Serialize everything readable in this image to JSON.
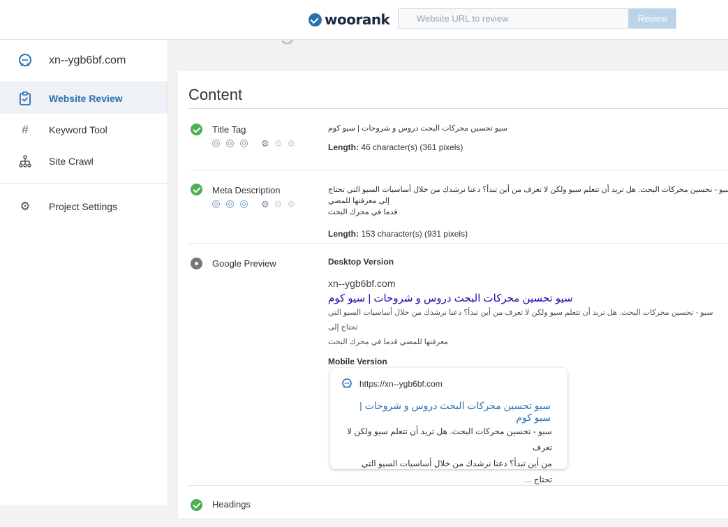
{
  "topbar": {
    "logo_text": "woorank",
    "url_placeholder": "Website URL to review",
    "review_label": "Review"
  },
  "sidebar": {
    "site_name": "xn--ygb6bf.com",
    "items": [
      {
        "label": "Website Review",
        "icon": "clipboard-check-icon",
        "active": true
      },
      {
        "label": "Keyword Tool",
        "icon": "hash-icon"
      },
      {
        "label": "Site Crawl",
        "icon": "sitemap-icon"
      },
      {
        "label": "Project Settings",
        "icon": "gear-icon"
      }
    ]
  },
  "page": {
    "heading": "On-Page",
    "section_title": "Content"
  },
  "criteria": {
    "title_tag": {
      "label": "Title Tag",
      "status": "pass",
      "value": "سيو تحسين محركات البحث دروس و شروحات | سيو كوم",
      "length_label": "Length:",
      "length_value": "46 character(s) (361 pixels)"
    },
    "meta_description": {
      "label": "Meta Description",
      "status": "pass",
      "value_line1": "سيو - تحسين محركات البحث. هل تريد أن تتعلم سيو ولكن لا تعرف من أين تبدأ؟ دعنا نرشدك من خلال أساسيات السيو التي تحتاج إلى معرفتها للمضي",
      "value_line2": "قدما في محرك البحث",
      "length_label": "Length:",
      "length_value": "153 character(s) (931 pixels)"
    },
    "google_preview": {
      "label": "Google Preview",
      "desktop_label": "Desktop Version",
      "desktop_url": "xn--ygb6bf.com",
      "desktop_title": "سيو تحسين محركات البحث دروس و شروحات | سيو كوم",
      "desktop_desc_line1": "سيو - تحسين محركات البحث. هل تريد أن تتعلم سيو ولكن لا تعرف من أين تبدأ؟ دعنا نرشدك من خلال أساسيات السيو التي تحتاج إلى",
      "desktop_desc_line2": "معرفتها للمضي قدما في محرك البحث",
      "mobile_label": "Mobile Version",
      "mobile_url": "https://xn--ygb6bf.com",
      "mobile_title": "سيو تحسين محركات البحث دروس و شروحات | سيو كوم",
      "mobile_desc_line1": "سيو - تحسين محركات البحث. هل تريد أن تتعلم سيو ولكن لا تعرف",
      "mobile_desc_line2": "من أين تبدأ؟ دعنا نرشدك من خلال أساسيات السيو التي تحتاج ..."
    },
    "headings": {
      "label": "Headings"
    }
  }
}
